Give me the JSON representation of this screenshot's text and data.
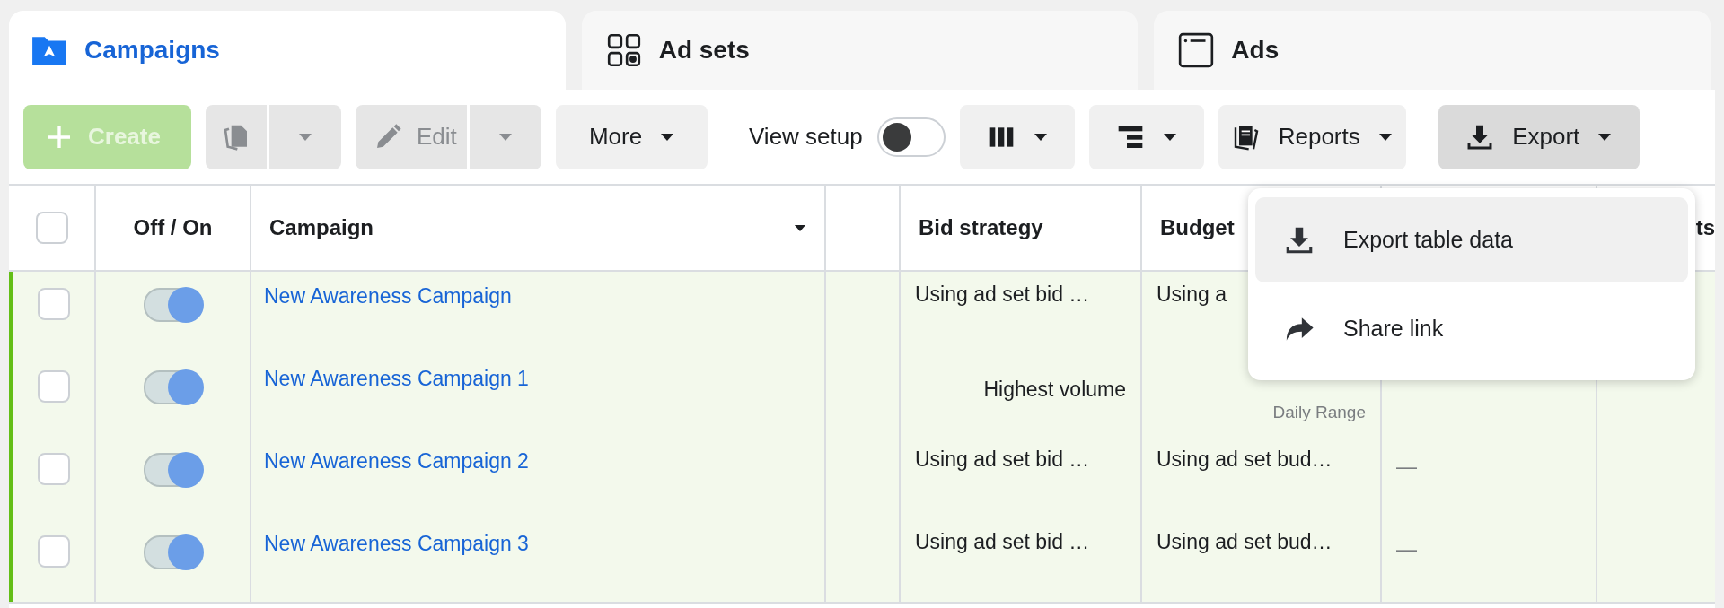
{
  "tabs": [
    {
      "label": "Campaigns",
      "selected": true
    },
    {
      "label": "Ad sets",
      "selected": false
    },
    {
      "label": "Ads",
      "selected": false
    }
  ],
  "toolbar": [
    {
      "kind": "button",
      "label": "Create",
      "disabled": true
    },
    {
      "kind": "split",
      "disabled": true
    },
    {
      "kind": "split",
      "label": "Edit",
      "disabled": true
    },
    {
      "kind": "menu",
      "label": "More",
      "expanded": false
    },
    {
      "kind": "toggle",
      "label": "View setup",
      "on": false
    },
    {
      "kind": "menu",
      "expanded": false
    },
    {
      "kind": "menu",
      "expanded": false
    },
    {
      "kind": "menu",
      "label": "Reports",
      "expanded": false
    },
    {
      "kind": "menu",
      "label": "Export",
      "expanded": true
    }
  ],
  "table": {
    "header_checked": false,
    "columns": [
      {
        "kind": "checkbox"
      },
      {
        "kind": "text",
        "label": "Off / On"
      },
      {
        "kind": "text",
        "label": "Campaign",
        "sortable": true
      },
      {
        "kind": "blank"
      },
      {
        "kind": "text",
        "label": "Bid strategy"
      },
      {
        "kind": "text",
        "label": "Budget"
      },
      {
        "kind": "blank"
      },
      {
        "kind": "text",
        "label": "ts"
      }
    ],
    "rows": [
      {
        "checked": false,
        "on": true,
        "name": "New Awareness Campaign",
        "bid_strategy": "Using ad set bid …",
        "budget": "Using a"
      },
      {
        "kind": "range",
        "checked": false,
        "on": true,
        "name": "New Awareness Campaign 1",
        "bid_strategy": "Highest volume",
        "budget_note": "Daily Range"
      },
      {
        "checked": false,
        "on": true,
        "name": "New Awareness Campaign 2",
        "bid_strategy": "Using ad set bid …",
        "budget": "Using ad set bud…",
        "column_7": "—"
      },
      {
        "checked": false,
        "on": true,
        "name": "New Awareness Campaign 3",
        "bid_strategy": "Using ad set bid …",
        "budget": "Using ad set bud…",
        "column_7": "—"
      }
    ]
  },
  "export_menu": [
    {
      "label": "Export table data",
      "selected": true
    },
    {
      "label": "Share link",
      "selected": false
    }
  ]
}
